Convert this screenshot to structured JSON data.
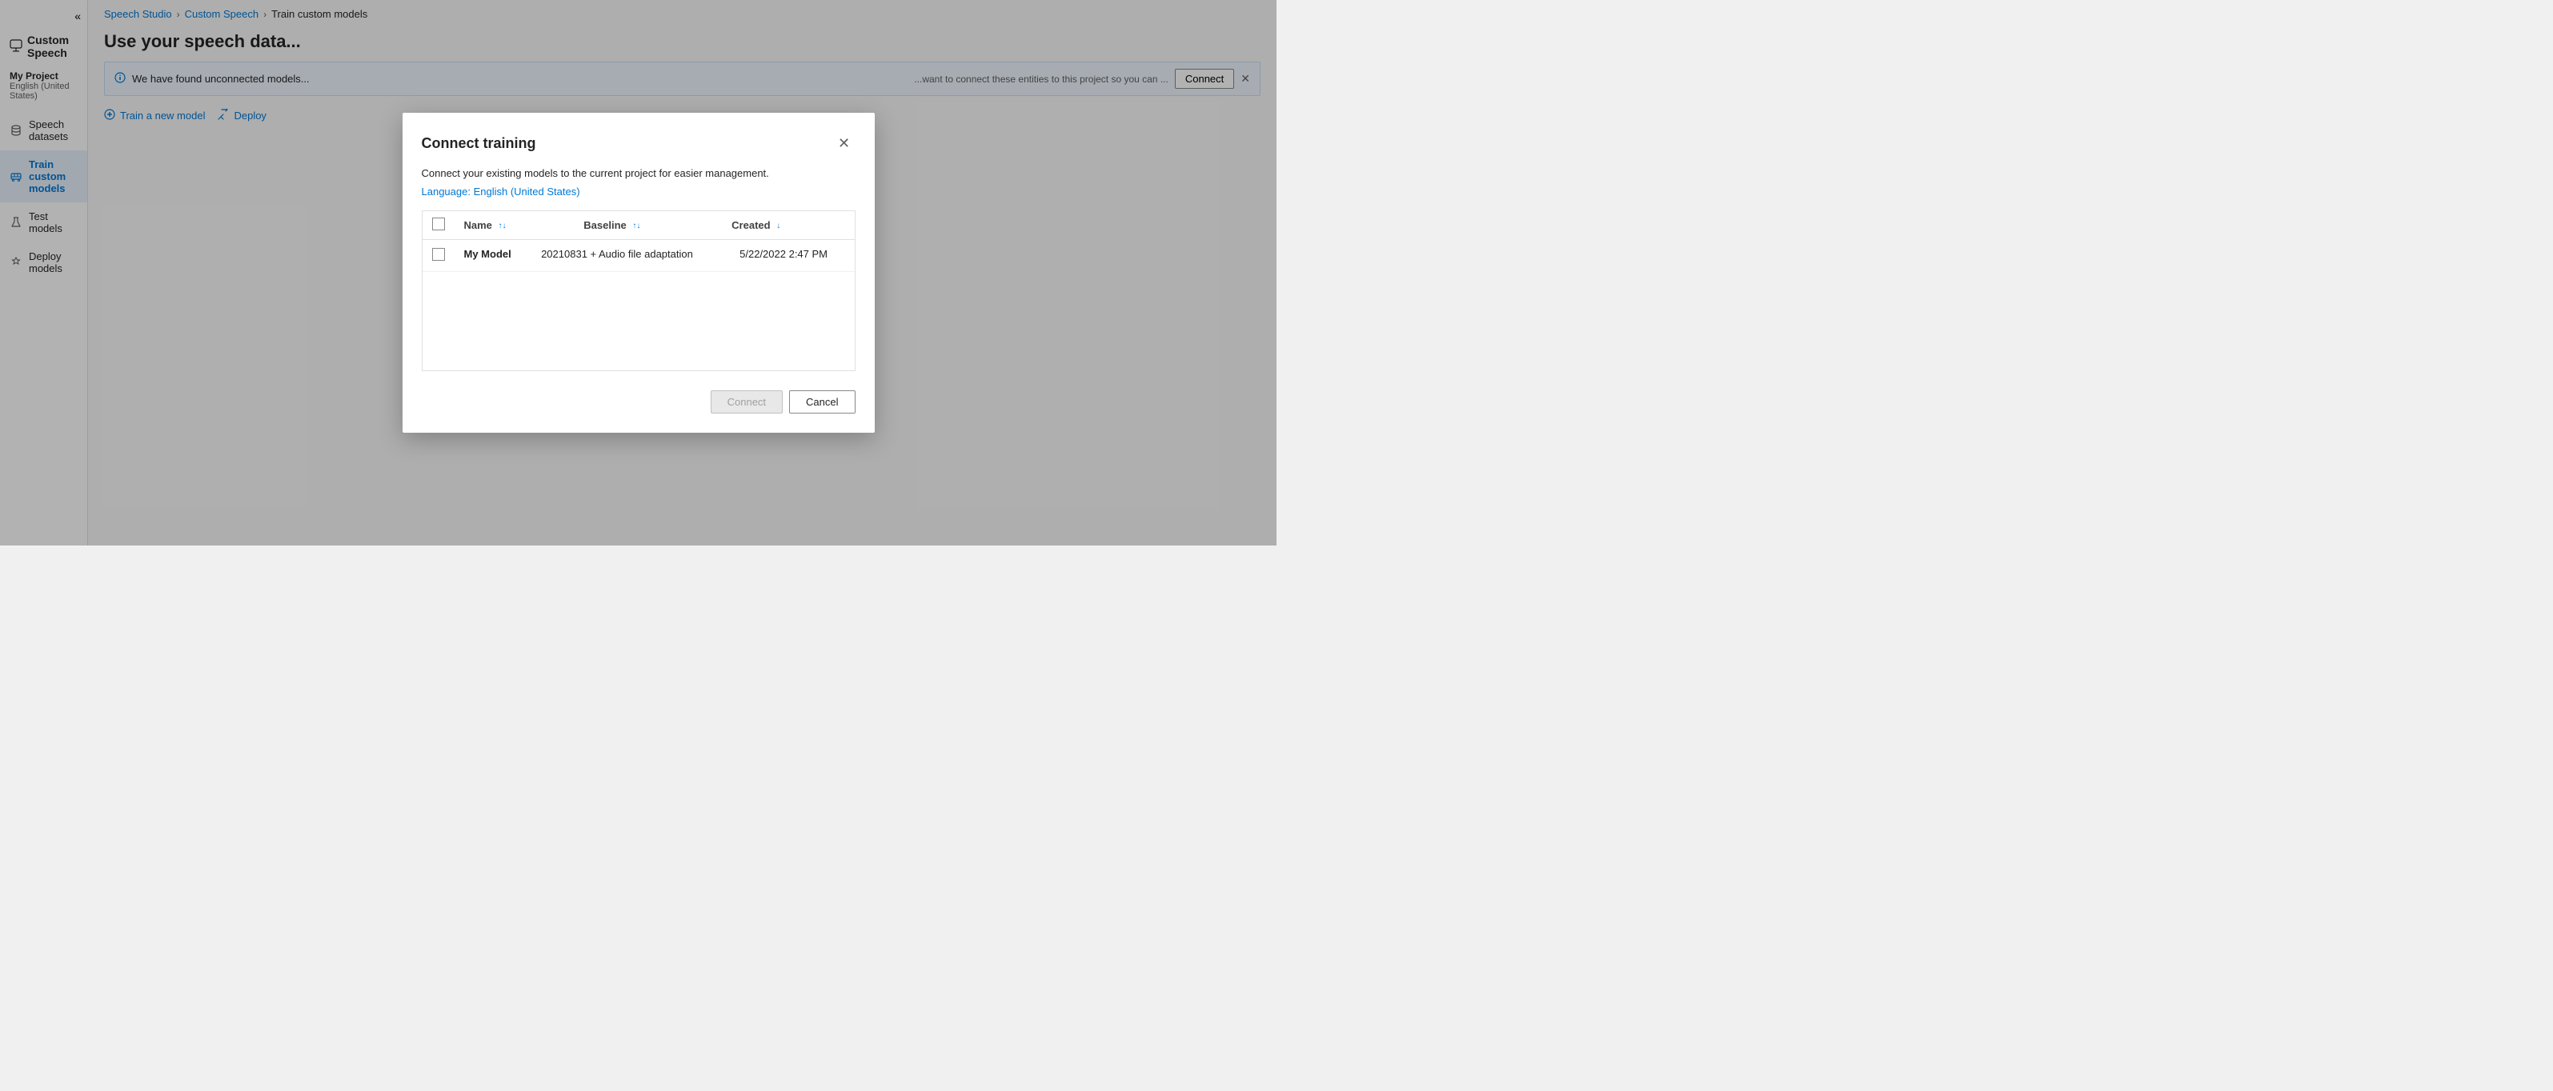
{
  "app": {
    "title": "Custom Speech"
  },
  "topbar": {
    "custom_speech_label": "Custom Speech"
  },
  "sidebar": {
    "collapse_label": "«",
    "title": "Custom Speech",
    "project_name": "My Project",
    "project_locale": "English (United States)",
    "nav_items": [
      {
        "id": "speech-datasets",
        "label": "Speech datasets",
        "icon": "database"
      },
      {
        "id": "train-custom-models",
        "label": "Train custom models",
        "icon": "train",
        "active": true
      },
      {
        "id": "test-models",
        "label": "Test models",
        "icon": "flask"
      },
      {
        "id": "deploy-models",
        "label": "Deploy models",
        "icon": "deploy"
      }
    ]
  },
  "breadcrumb": {
    "items": [
      {
        "label": "Speech Studio",
        "link": true
      },
      {
        "label": "Custom Speech",
        "link": true
      },
      {
        "label": "Train custom models",
        "link": false
      }
    ]
  },
  "page": {
    "title": "Use your speech data...",
    "info_banner": {
      "message": "We have found unconnected models...",
      "connect_label": "Connect",
      "close_label": "×"
    },
    "toolbar": {
      "train_label": "Train a new model",
      "deploy_label": "Deploy"
    }
  },
  "dialog": {
    "title": "Connect training",
    "description": "Connect your existing models to the current project for easier management.",
    "language_label": "Language:",
    "language_value": "English (United States)",
    "table": {
      "columns": [
        {
          "id": "name",
          "label": "Name",
          "sortable": true
        },
        {
          "id": "baseline",
          "label": "Baseline",
          "sortable": true
        },
        {
          "id": "created",
          "label": "Created",
          "sortable": true,
          "sort_active": true
        }
      ],
      "rows": [
        {
          "id": "row-1",
          "name": "My Model",
          "baseline": "20210831 + Audio file adaptation",
          "created": "5/22/2022 2:47 PM"
        }
      ]
    },
    "footer": {
      "connect_label": "Connect",
      "cancel_label": "Cancel"
    }
  }
}
